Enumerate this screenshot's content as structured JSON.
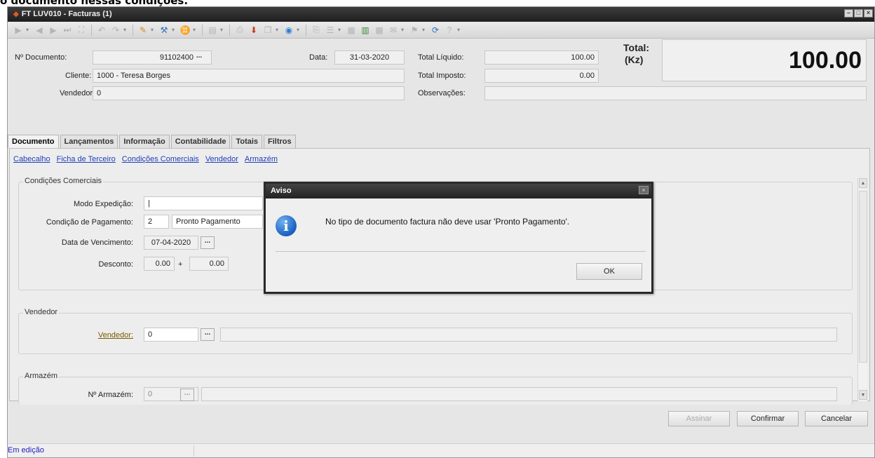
{
  "caption": "o documento nessas condições.",
  "window": {
    "title": "FT LUV010 - Facturas (1)"
  },
  "header": {
    "doc_label": "Nº Documento:",
    "doc_value": "91102400",
    "date_label": "Data:",
    "date_value": "31-03-2020",
    "client_label": "Cliente:",
    "client_value": "1000 - Teresa Borges",
    "seller_label": "Vendedor:",
    "seller_value": "0",
    "net_label": "Total Líquido:",
    "net_value": "100.00",
    "tax_label": "Total Imposto:",
    "tax_value": "0.00",
    "obs_label": "Observações:",
    "obs_value": "",
    "total_label_1": "Total:",
    "total_label_2": "(Kz)",
    "total_value": "100.00",
    "dots": "..."
  },
  "tabs": [
    "Documento",
    "Lançamentos",
    "Informação",
    "Contabilidade",
    "Totais",
    "Filtros"
  ],
  "sublinks": [
    "Cabecalho",
    "Ficha de Terceiro",
    "Condições Comerciais",
    "Vendedor",
    "Armazém"
  ],
  "commercial": {
    "title": "Condições Comerciais",
    "shipping_label": "Modo Expedição:",
    "shipping_value": "|",
    "payment_label": "Condição de Pagamento:",
    "payment_code": "2",
    "payment_desc": "Pronto Pagamento",
    "due_label": "Data de Vencimento:",
    "due_value": "07-04-2020",
    "discount_label": "Desconto:",
    "discount_1": "0.00",
    "discount_plus": "+",
    "discount_2": "0.00"
  },
  "vendor_group": {
    "title": "Vendedor",
    "link": "Vendedor:",
    "value": "0"
  },
  "warehouse_group": {
    "title": "Armazém",
    "label": "Nº Armazém:",
    "value": "0"
  },
  "dialog": {
    "title": "Aviso",
    "message": "No tipo de documento factura não deve usar 'Pronto Pagamento'.",
    "ok": "OK",
    "close": "×"
  },
  "buttons": {
    "sign": "Assinar",
    "confirm": "Confirmar",
    "cancel": "Cancelar"
  },
  "status": "Em edição"
}
